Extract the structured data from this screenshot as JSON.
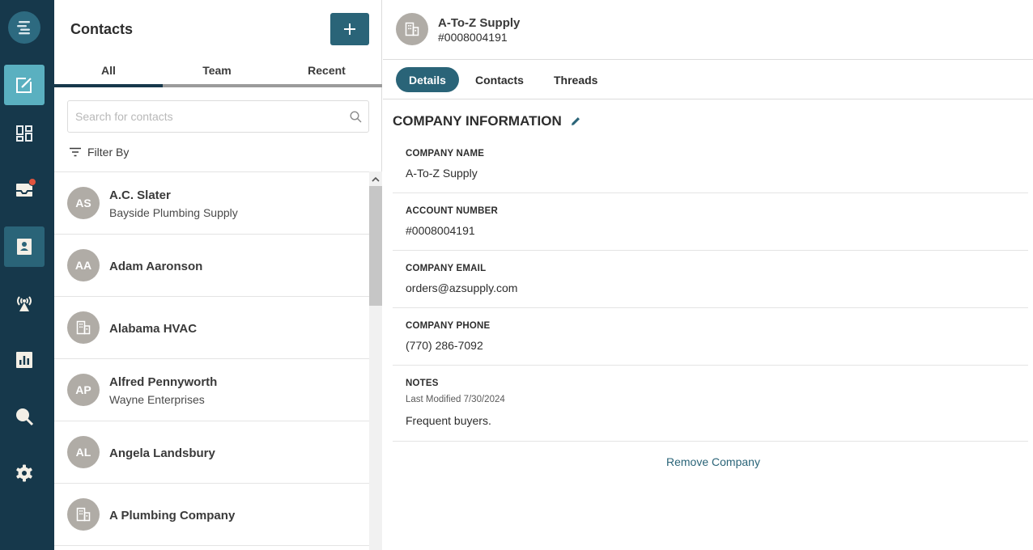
{
  "rail": {
    "items": [
      {
        "icon": "compose-icon"
      },
      {
        "icon": "dashboard-icon"
      },
      {
        "icon": "inbox-icon"
      },
      {
        "icon": "contacts-book-icon"
      },
      {
        "icon": "broadcast-icon"
      },
      {
        "icon": "reports-icon"
      },
      {
        "icon": "search-icon"
      },
      {
        "icon": "settings-icon"
      }
    ],
    "colors": {
      "background": "#16384b",
      "active_light": "#5ab0c0",
      "active_dark": "#2a6478",
      "notification": "#e0533d"
    }
  },
  "contacts": {
    "title": "Contacts",
    "tabs": [
      {
        "label": "All"
      },
      {
        "label": "Team"
      },
      {
        "label": "Recent"
      }
    ],
    "search": {
      "placeholder": "Search for contacts",
      "value": ""
    },
    "filter_label": "Filter By",
    "items": [
      {
        "initials": "AS",
        "name": "A.C. Slater",
        "subtitle": "Bayside Plumbing Supply",
        "type": "person"
      },
      {
        "initials": "AA",
        "name": "Adam Aaronson",
        "subtitle": "",
        "type": "person"
      },
      {
        "initials": "",
        "name": "Alabama HVAC",
        "subtitle": "",
        "type": "company"
      },
      {
        "initials": "AP",
        "name": "Alfred Pennyworth",
        "subtitle": "Wayne Enterprises",
        "type": "person"
      },
      {
        "initials": "AL",
        "name": "Angela Landsbury",
        "subtitle": "",
        "type": "person"
      },
      {
        "initials": "",
        "name": "A Plumbing Company",
        "subtitle": "",
        "type": "company"
      }
    ]
  },
  "detail": {
    "name": "A-To-Z Supply",
    "number": "#0008004191",
    "tabs": [
      {
        "label": "Details"
      },
      {
        "label": "Contacts"
      },
      {
        "label": "Threads"
      }
    ],
    "section_title": "COMPANY INFORMATION",
    "fields": {
      "company_name": {
        "label": "COMPANY NAME",
        "value": "A-To-Z Supply"
      },
      "account_number": {
        "label": "ACCOUNT NUMBER",
        "value": "#0008004191"
      },
      "company_email": {
        "label": "COMPANY EMAIL",
        "value": "orders@azsupply.com"
      },
      "company_phone": {
        "label": "COMPANY PHONE",
        "value": "(770) 286-7092"
      },
      "notes": {
        "label": "NOTES",
        "meta": "Last Modified 7/30/2024",
        "value": "Frequent buyers."
      }
    },
    "remove_label": "Remove Company"
  }
}
